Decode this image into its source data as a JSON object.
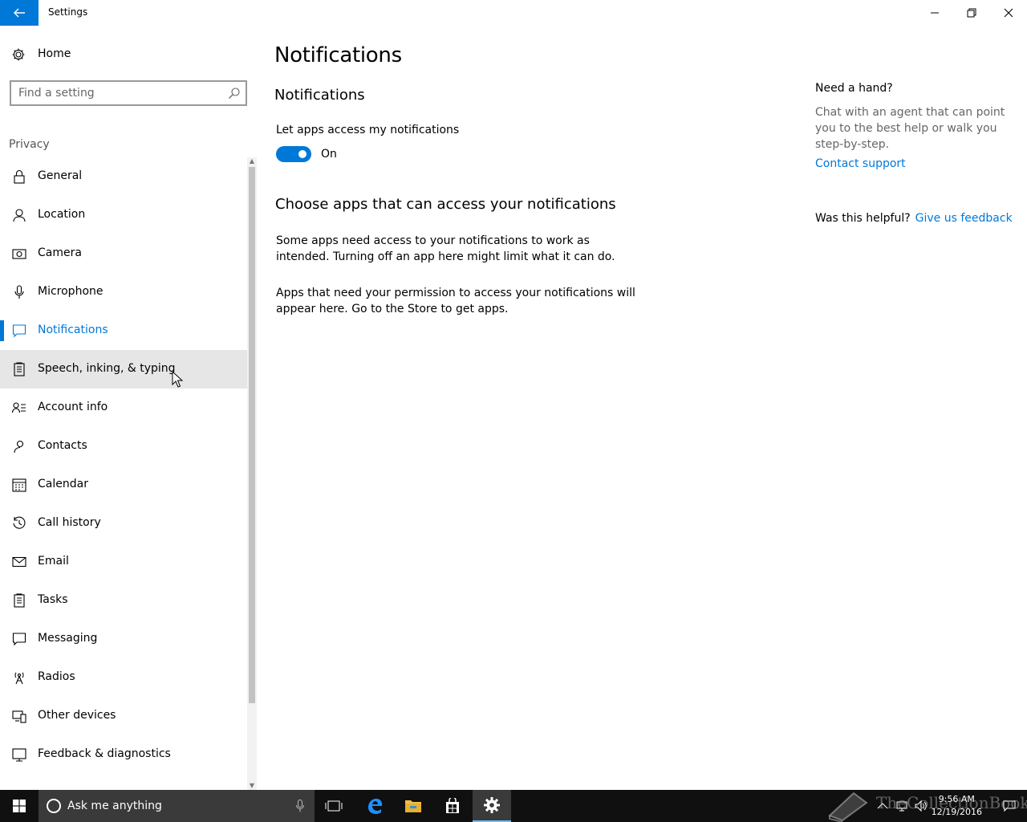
{
  "window": {
    "title": "Settings",
    "minimize_glyph": "–",
    "restore_glyph": "❐",
    "close_glyph": "✕"
  },
  "sidebar": {
    "home_label": "Home",
    "search_placeholder": "Find a setting",
    "section_label": "Privacy",
    "items": [
      {
        "label": "General",
        "icon": "lock-icon"
      },
      {
        "label": "Location",
        "icon": "location-icon"
      },
      {
        "label": "Camera",
        "icon": "camera-icon"
      },
      {
        "label": "Microphone",
        "icon": "microphone-icon"
      },
      {
        "label": "Notifications",
        "icon": "notification-icon",
        "active": true
      },
      {
        "label": "Speech, inking, & typing",
        "icon": "speech-icon",
        "hover": true
      },
      {
        "label": "Account info",
        "icon": "account-icon"
      },
      {
        "label": "Contacts",
        "icon": "contacts-icon"
      },
      {
        "label": "Calendar",
        "icon": "calendar-icon"
      },
      {
        "label": "Call history",
        "icon": "history-icon"
      },
      {
        "label": "Email",
        "icon": "email-icon"
      },
      {
        "label": "Tasks",
        "icon": "tasks-icon"
      },
      {
        "label": "Messaging",
        "icon": "messaging-icon"
      },
      {
        "label": "Radios",
        "icon": "radio-icon"
      },
      {
        "label": "Other devices",
        "icon": "devices-icon"
      },
      {
        "label": "Feedback & diagnostics",
        "icon": "feedback-icon"
      }
    ]
  },
  "main": {
    "page_title": "Notifications",
    "sub_title": "Notifications",
    "toggle_label": "Let apps access my notifications",
    "toggle_state": "On",
    "toggle_on": true,
    "section_title": "Choose apps that can access your notifications",
    "paragraph1": "Some apps need access to your notifications to work as intended. Turning off an app here might limit what it can do.",
    "paragraph2": "Apps that need your permission to access your notifications will appear here. Go to the Store to get apps."
  },
  "help": {
    "title": "Need a hand?",
    "text": "Chat with an agent that can point you to the best help or walk you step-by-step.",
    "link": "Contact support",
    "helpful_question": "Was this helpful?",
    "feedback_link": "Give us feedback"
  },
  "taskbar": {
    "search_text": "Ask me anything",
    "time": "9:56 AM",
    "date": "12/19/2016"
  },
  "watermark": "TheCollectionBook",
  "colors": {
    "accent": "#0078d7",
    "taskbar": "#101010"
  }
}
